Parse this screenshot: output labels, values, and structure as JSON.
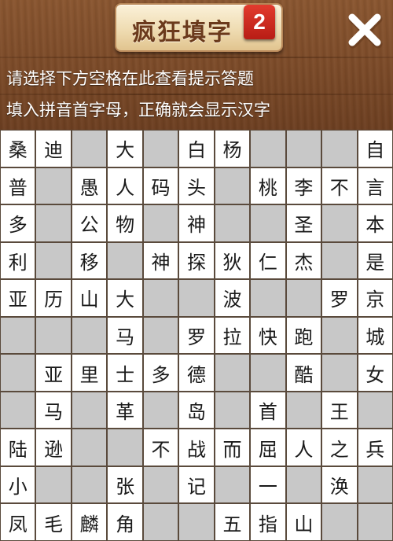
{
  "header": {
    "title": "疯狂填字",
    "badge": "2"
  },
  "hints": {
    "line1": "请选择下方空格在此查看提示答题",
    "line2": "填入拼音首字母，正确就会显示汉字"
  },
  "icons": {
    "close": "close-icon"
  },
  "colors": {
    "wood": "#7b4a28",
    "blank_cell": "#c8c8c8",
    "text_cell": "#ffffff",
    "badge": "#c8261c"
  },
  "grid": {
    "rows": [
      [
        "桑",
        "迪",
        "",
        "大",
        "",
        "白",
        "杨",
        "",
        "",
        "",
        "自"
      ],
      [
        "普",
        "",
        "愚",
        "人",
        "码",
        "头",
        "",
        "桃",
        "李",
        "不",
        "言"
      ],
      [
        "多",
        "",
        "公",
        "物",
        "",
        "神",
        "",
        "",
        "圣",
        "",
        "本"
      ],
      [
        "利",
        "",
        "移",
        "",
        "神",
        "探",
        "狄",
        "仁",
        "杰",
        "",
        "是"
      ],
      [
        "亚",
        "历",
        "山",
        "大",
        "",
        "",
        "波",
        "",
        "",
        "罗",
        "京"
      ],
      [
        "",
        "",
        "",
        "马",
        "",
        "罗",
        "拉",
        "快",
        "跑",
        "",
        "城"
      ],
      [
        "",
        "亚",
        "里",
        "士",
        "多",
        "德",
        "",
        "",
        "酷",
        "",
        "女"
      ],
      [
        "",
        "马",
        "",
        "革",
        "",
        "岛",
        "",
        "首",
        "",
        "王",
        ""
      ],
      [
        "陆",
        "逊",
        "",
        "",
        "不",
        "战",
        "而",
        "屈",
        "人",
        "之",
        "兵"
      ],
      [
        "小",
        "",
        "",
        "张",
        "",
        "记",
        "",
        "一",
        "",
        "涣",
        ""
      ],
      [
        "凤",
        "毛",
        "麟",
        "角",
        "",
        "",
        "五",
        "指",
        "山",
        "",
        ""
      ]
    ]
  }
}
